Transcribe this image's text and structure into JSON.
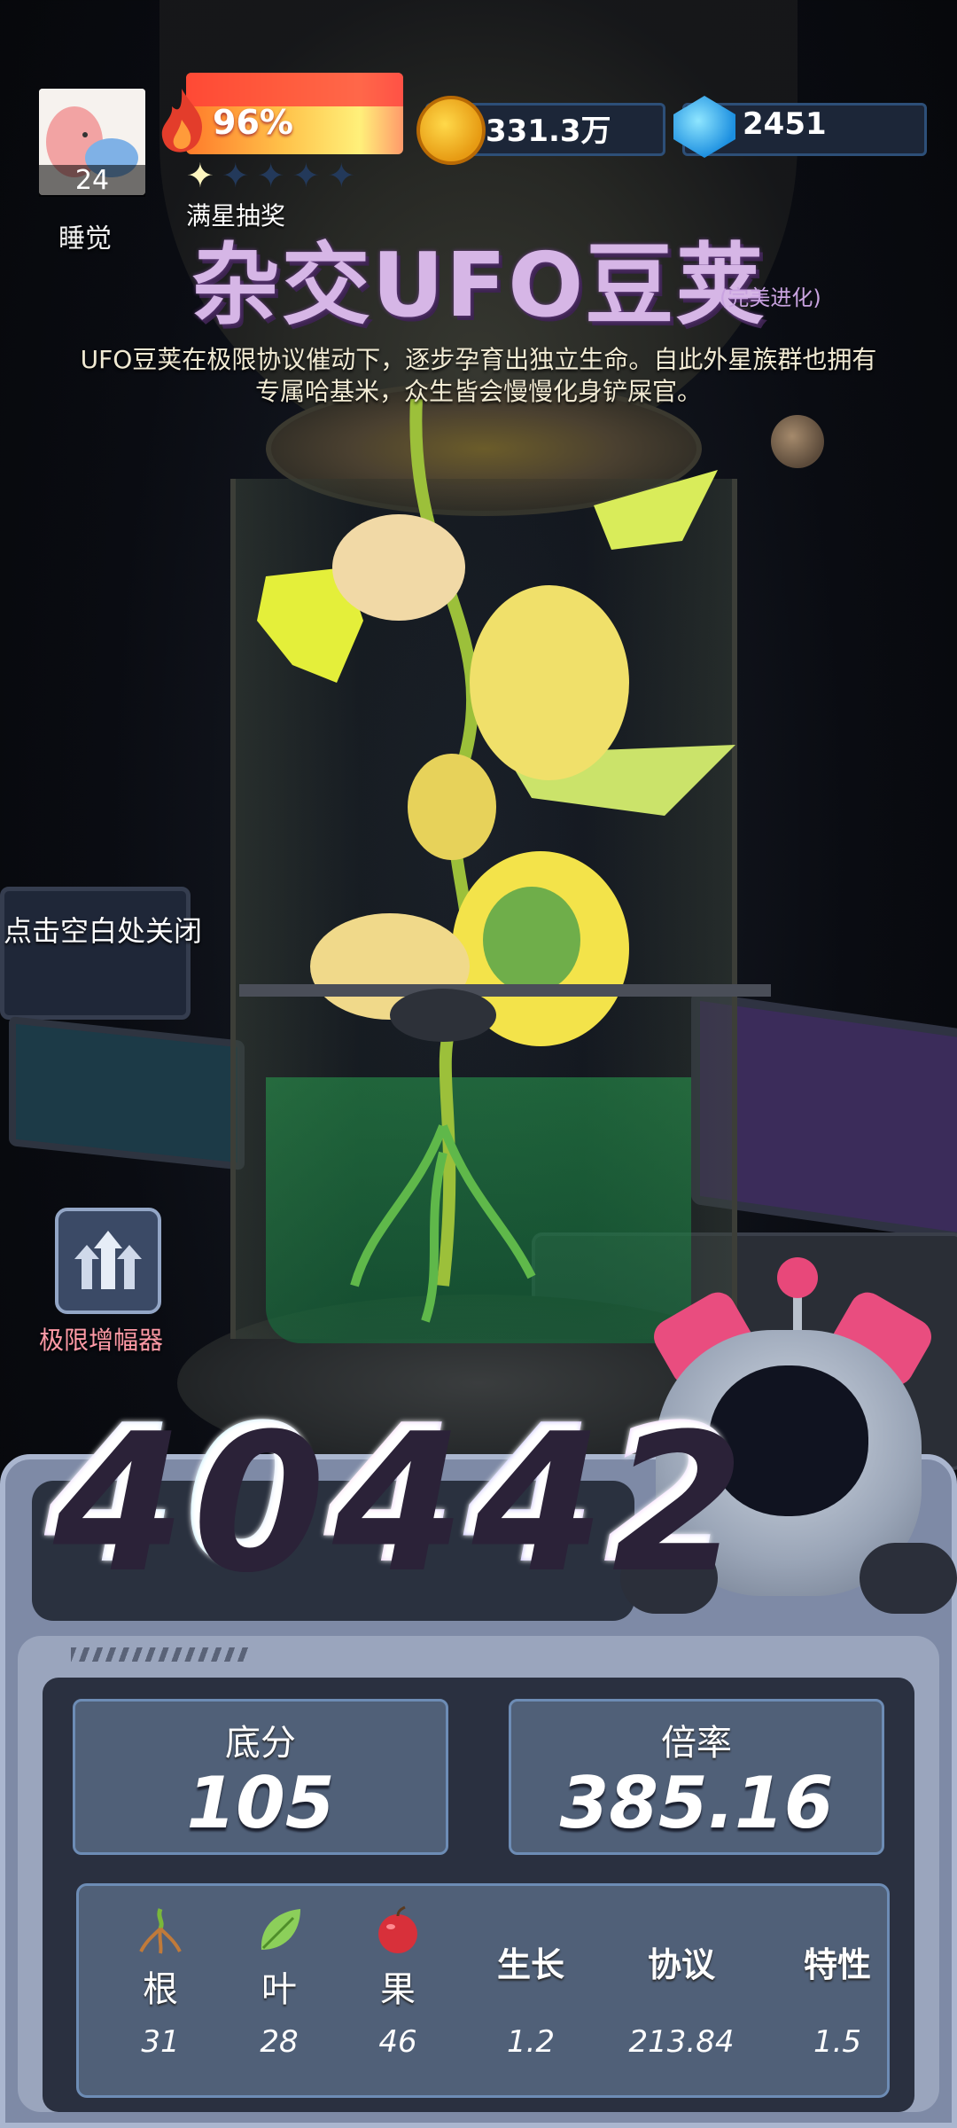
{
  "player": {
    "level": "24",
    "status_label": "睡觉"
  },
  "fire": {
    "percent_text": "96%",
    "percent": 96
  },
  "stars": {
    "label": "满星抽奖",
    "filled": 1,
    "total": 5
  },
  "currency": {
    "coins": "331.3万",
    "gems": "2451"
  },
  "item": {
    "title": "杂交UFO豆荚",
    "tag": "(完美进化)",
    "description_line1": "UFO豆荚在极限协议催动下，逐步孕育出独立生命。自此外星族群也拥有",
    "description_line2": "专属哈基米，众生皆会慢慢化身铲屎官。"
  },
  "hint": {
    "close": "点击空白处关闭"
  },
  "amplifier": {
    "label": "极限增幅器",
    "icon": "triple-up-arrows-icon"
  },
  "score": {
    "total": "40442"
  },
  "stats": {
    "base_label": "底分",
    "base_value": "105",
    "multiplier_label": "倍率",
    "multiplier_value": "385.16"
  },
  "attributes": [
    {
      "name": "根",
      "value": "31",
      "icon": "root-icon"
    },
    {
      "name": "叶",
      "value": "28",
      "icon": "leaf-icon"
    },
    {
      "name": "果",
      "value": "46",
      "icon": "apple-icon"
    },
    {
      "name": "生长",
      "value": "1.2"
    },
    {
      "name": "协议",
      "value": "213.84"
    },
    {
      "name": "特性",
      "value": "1.5"
    }
  ],
  "colors": {
    "title": "#d6b6e6",
    "panel": "#506078",
    "amp_label": "#ff9aa6"
  }
}
